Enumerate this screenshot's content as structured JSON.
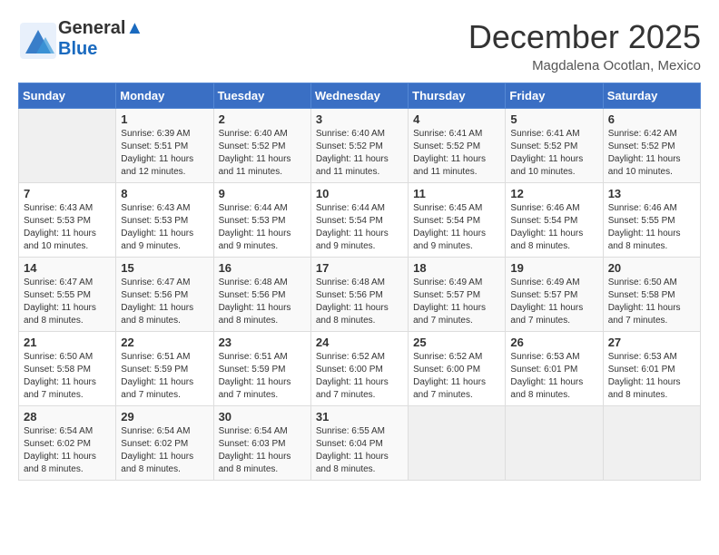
{
  "header": {
    "logo_line1": "General",
    "logo_line2": "Blue",
    "month": "December 2025",
    "location": "Magdalena Ocotlan, Mexico"
  },
  "weekdays": [
    "Sunday",
    "Monday",
    "Tuesday",
    "Wednesday",
    "Thursday",
    "Friday",
    "Saturday"
  ],
  "weeks": [
    [
      {
        "day": "",
        "info": ""
      },
      {
        "day": "1",
        "info": "Sunrise: 6:39 AM\nSunset: 5:51 PM\nDaylight: 11 hours\nand 12 minutes."
      },
      {
        "day": "2",
        "info": "Sunrise: 6:40 AM\nSunset: 5:52 PM\nDaylight: 11 hours\nand 11 minutes."
      },
      {
        "day": "3",
        "info": "Sunrise: 6:40 AM\nSunset: 5:52 PM\nDaylight: 11 hours\nand 11 minutes."
      },
      {
        "day": "4",
        "info": "Sunrise: 6:41 AM\nSunset: 5:52 PM\nDaylight: 11 hours\nand 11 minutes."
      },
      {
        "day": "5",
        "info": "Sunrise: 6:41 AM\nSunset: 5:52 PM\nDaylight: 11 hours\nand 10 minutes."
      },
      {
        "day": "6",
        "info": "Sunrise: 6:42 AM\nSunset: 5:52 PM\nDaylight: 11 hours\nand 10 minutes."
      }
    ],
    [
      {
        "day": "7",
        "info": "Sunrise: 6:43 AM\nSunset: 5:53 PM\nDaylight: 11 hours\nand 10 minutes."
      },
      {
        "day": "8",
        "info": "Sunrise: 6:43 AM\nSunset: 5:53 PM\nDaylight: 11 hours\nand 9 minutes."
      },
      {
        "day": "9",
        "info": "Sunrise: 6:44 AM\nSunset: 5:53 PM\nDaylight: 11 hours\nand 9 minutes."
      },
      {
        "day": "10",
        "info": "Sunrise: 6:44 AM\nSunset: 5:54 PM\nDaylight: 11 hours\nand 9 minutes."
      },
      {
        "day": "11",
        "info": "Sunrise: 6:45 AM\nSunset: 5:54 PM\nDaylight: 11 hours\nand 9 minutes."
      },
      {
        "day": "12",
        "info": "Sunrise: 6:46 AM\nSunset: 5:54 PM\nDaylight: 11 hours\nand 8 minutes."
      },
      {
        "day": "13",
        "info": "Sunrise: 6:46 AM\nSunset: 5:55 PM\nDaylight: 11 hours\nand 8 minutes."
      }
    ],
    [
      {
        "day": "14",
        "info": "Sunrise: 6:47 AM\nSunset: 5:55 PM\nDaylight: 11 hours\nand 8 minutes."
      },
      {
        "day": "15",
        "info": "Sunrise: 6:47 AM\nSunset: 5:56 PM\nDaylight: 11 hours\nand 8 minutes."
      },
      {
        "day": "16",
        "info": "Sunrise: 6:48 AM\nSunset: 5:56 PM\nDaylight: 11 hours\nand 8 minutes."
      },
      {
        "day": "17",
        "info": "Sunrise: 6:48 AM\nSunset: 5:56 PM\nDaylight: 11 hours\nand 8 minutes."
      },
      {
        "day": "18",
        "info": "Sunrise: 6:49 AM\nSunset: 5:57 PM\nDaylight: 11 hours\nand 7 minutes."
      },
      {
        "day": "19",
        "info": "Sunrise: 6:49 AM\nSunset: 5:57 PM\nDaylight: 11 hours\nand 7 minutes."
      },
      {
        "day": "20",
        "info": "Sunrise: 6:50 AM\nSunset: 5:58 PM\nDaylight: 11 hours\nand 7 minutes."
      }
    ],
    [
      {
        "day": "21",
        "info": "Sunrise: 6:50 AM\nSunset: 5:58 PM\nDaylight: 11 hours\nand 7 minutes."
      },
      {
        "day": "22",
        "info": "Sunrise: 6:51 AM\nSunset: 5:59 PM\nDaylight: 11 hours\nand 7 minutes."
      },
      {
        "day": "23",
        "info": "Sunrise: 6:51 AM\nSunset: 5:59 PM\nDaylight: 11 hours\nand 7 minutes."
      },
      {
        "day": "24",
        "info": "Sunrise: 6:52 AM\nSunset: 6:00 PM\nDaylight: 11 hours\nand 7 minutes."
      },
      {
        "day": "25",
        "info": "Sunrise: 6:52 AM\nSunset: 6:00 PM\nDaylight: 11 hours\nand 7 minutes."
      },
      {
        "day": "26",
        "info": "Sunrise: 6:53 AM\nSunset: 6:01 PM\nDaylight: 11 hours\nand 8 minutes."
      },
      {
        "day": "27",
        "info": "Sunrise: 6:53 AM\nSunset: 6:01 PM\nDaylight: 11 hours\nand 8 minutes."
      }
    ],
    [
      {
        "day": "28",
        "info": "Sunrise: 6:54 AM\nSunset: 6:02 PM\nDaylight: 11 hours\nand 8 minutes."
      },
      {
        "day": "29",
        "info": "Sunrise: 6:54 AM\nSunset: 6:02 PM\nDaylight: 11 hours\nand 8 minutes."
      },
      {
        "day": "30",
        "info": "Sunrise: 6:54 AM\nSunset: 6:03 PM\nDaylight: 11 hours\nand 8 minutes."
      },
      {
        "day": "31",
        "info": "Sunrise: 6:55 AM\nSunset: 6:04 PM\nDaylight: 11 hours\nand 8 minutes."
      },
      {
        "day": "",
        "info": ""
      },
      {
        "day": "",
        "info": ""
      },
      {
        "day": "",
        "info": ""
      }
    ]
  ]
}
